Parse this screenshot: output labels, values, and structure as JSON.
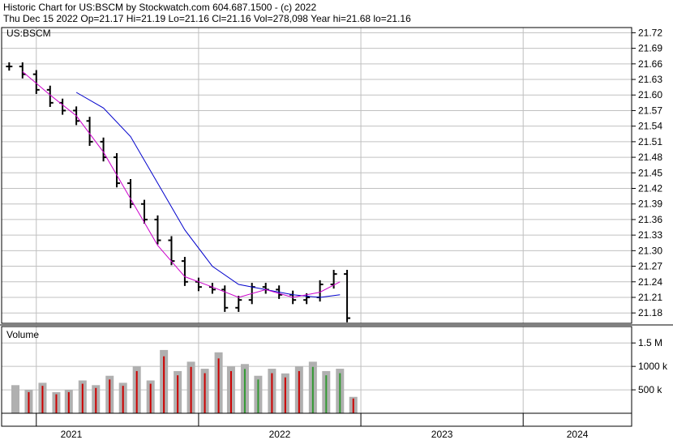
{
  "header": {
    "line1": "Historic Chart for US:BSCM by Stockwatch.com 604.687.1500 - (c) 2022",
    "line2": "Thu Dec 15 2022  Op=21.17  Hi=21.19  Lo=21.16  Cl=21.16  Vol=278,098  Year hi=21.68  lo=21.16"
  },
  "colors": {
    "price_bar": "#000000",
    "ma_short": "#cc00cc",
    "ma_long": "#0000cc",
    "grid": "#c0c0c0",
    "vol_up": "#339933",
    "vol_down": "#cc0000",
    "vol_neutral": "#b0b0b0"
  },
  "chart_data": [
    {
      "type": "line",
      "panel": "price",
      "title": "US:BSCM",
      "ylim": [
        21.16,
        21.73
      ],
      "y_ticks": [
        "21.72",
        "21.69",
        "21.66",
        "21.63",
        "21.60",
        "21.57",
        "21.54",
        "21.51",
        "21.48",
        "21.45",
        "21.42",
        "21.39",
        "21.36",
        "21.33",
        "21.30",
        "21.27",
        "21.24",
        "21.21",
        "21.18"
      ],
      "grid": true,
      "series": [
        {
          "style": "ohlc_bars",
          "x": [
            "2020-11-01",
            "2020-12-01",
            "2021-01-01",
            "2021-02-01",
            "2021-03-01",
            "2021-04-01",
            "2021-05-01",
            "2021-06-01",
            "2021-07-01",
            "2021-08-01",
            "2021-09-01",
            "2021-10-01",
            "2021-11-01",
            "2021-12-01",
            "2022-01-01",
            "2022-02-01",
            "2022-03-01",
            "2022-04-01",
            "2022-05-01",
            "2022-06-01",
            "2022-07-01",
            "2022-08-01",
            "2022-09-01",
            "2022-10-01",
            "2022-11-01",
            "2022-12-01"
          ],
          "values": [
            21.655,
            21.64,
            21.61,
            21.585,
            21.57,
            21.55,
            21.51,
            21.48,
            21.43,
            21.39,
            21.36,
            21.32,
            21.28,
            21.24,
            21.23,
            21.225,
            21.19,
            21.205,
            21.23,
            21.225,
            21.215,
            21.205,
            21.21,
            21.235,
            21.255,
            21.17
          ]
        },
        {
          "style": "moving_average_short",
          "x": [
            "2020-12-01",
            "2021-02-01",
            "2021-04-01",
            "2021-06-01",
            "2021-08-01",
            "2021-10-01",
            "2021-12-01",
            "2022-02-01",
            "2022-04-01",
            "2022-06-01",
            "2022-08-01",
            "2022-10-01",
            "2022-11-15"
          ],
          "values": [
            21.645,
            21.6,
            21.56,
            21.49,
            21.4,
            21.31,
            21.25,
            21.23,
            21.21,
            21.225,
            21.21,
            21.22,
            21.24
          ]
        },
        {
          "style": "moving_average_long",
          "x": [
            "2021-04-01",
            "2021-06-01",
            "2021-08-01",
            "2021-10-01",
            "2021-12-01",
            "2022-02-01",
            "2022-04-01",
            "2022-06-01",
            "2022-08-01",
            "2022-10-01",
            "2022-11-15"
          ],
          "values": [
            21.605,
            21.575,
            21.52,
            21.43,
            21.34,
            21.27,
            21.235,
            21.225,
            21.215,
            21.21,
            21.215
          ]
        }
      ]
    },
    {
      "type": "bar",
      "panel": "volume",
      "title": "Volume",
      "y_ticks": [
        "1.5 M",
        "1000 k",
        "500 k"
      ],
      "ylim": [
        0,
        1850000
      ],
      "grid": true,
      "x_ticks": [
        "2021",
        "2022",
        "2023",
        "2024"
      ],
      "series": [
        {
          "x": [
            "2020-11-15",
            "2020-12-15",
            "2021-01-15",
            "2021-02-15",
            "2021-03-15",
            "2021-04-15",
            "2021-05-15",
            "2021-06-15",
            "2021-07-15",
            "2021-08-15",
            "2021-09-15",
            "2021-10-15",
            "2021-11-15",
            "2021-12-15",
            "2022-01-15",
            "2022-02-15",
            "2022-03-15",
            "2022-04-15",
            "2022-05-15",
            "2022-06-15",
            "2022-07-15",
            "2022-08-15",
            "2022-09-15",
            "2022-10-15",
            "2022-11-15",
            "2022-12-15"
          ],
          "values": [
            600000,
            500000,
            650000,
            450000,
            500000,
            700000,
            600000,
            800000,
            650000,
            1000000,
            700000,
            1350000,
            900000,
            1100000,
            950000,
            1300000,
            1000000,
            1050000,
            800000,
            950000,
            850000,
            1000000,
            1100000,
            900000,
            950000,
            350000
          ]
        }
      ]
    }
  ]
}
